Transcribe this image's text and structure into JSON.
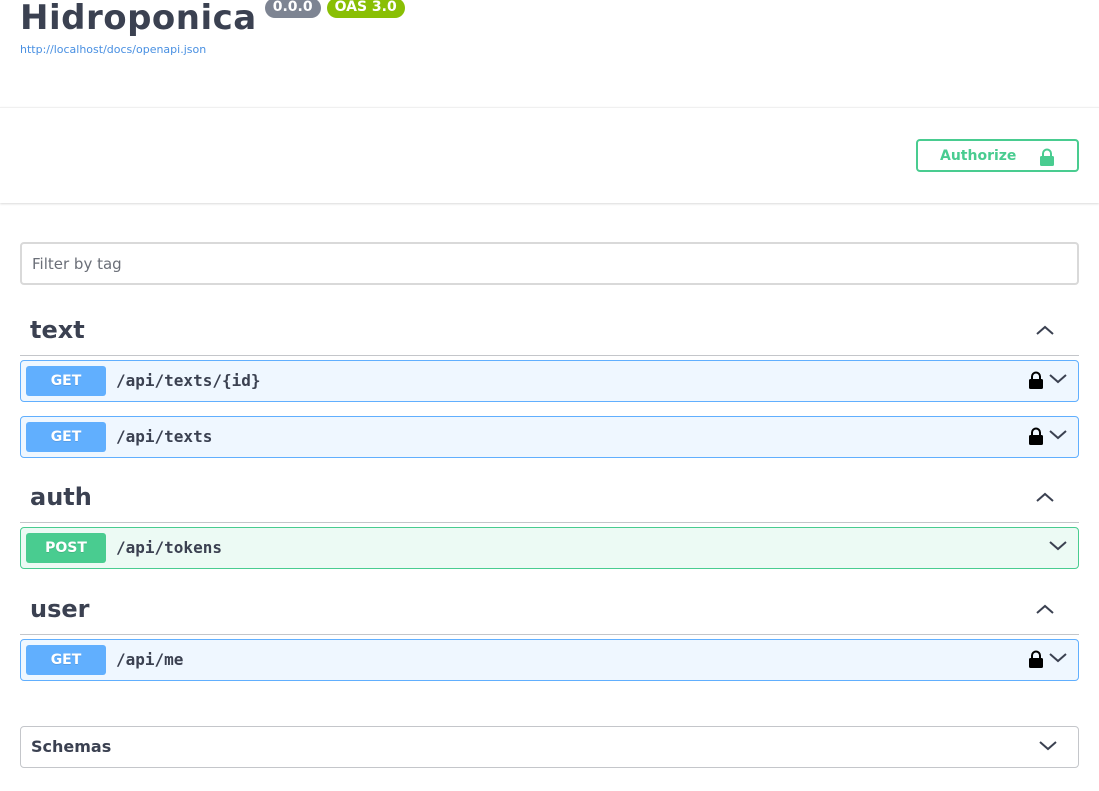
{
  "info": {
    "title": "Hidroponica",
    "version": "0.0.0",
    "oas": "OAS 3.0",
    "spec_url": "http://localhost/docs/openapi.json"
  },
  "auth": {
    "authorize_label": "Authorize"
  },
  "filter": {
    "placeholder": "Filter by tag",
    "value": ""
  },
  "tags": [
    {
      "name": "text",
      "operations": [
        {
          "method": "GET",
          "path": "/api/texts/{id}",
          "locked": true
        },
        {
          "method": "GET",
          "path": "/api/texts",
          "locked": true
        }
      ]
    },
    {
      "name": "auth",
      "operations": [
        {
          "method": "POST",
          "path": "/api/tokens",
          "locked": false
        }
      ]
    },
    {
      "name": "user",
      "operations": [
        {
          "method": "GET",
          "path": "/api/me",
          "locked": true
        }
      ]
    }
  ],
  "schemas": {
    "title": "Schemas"
  },
  "colors": {
    "get": "#61affe",
    "post": "#49cc90",
    "text": "#3b4151",
    "link": "#4990e2",
    "version_badge": "#7d8492",
    "oas_badge": "#89bf04"
  },
  "icons": {
    "lock": "lock-icon",
    "unlock": "unlock-icon",
    "chevron_up": "chevron-up-icon",
    "chevron_down": "chevron-down-icon"
  }
}
